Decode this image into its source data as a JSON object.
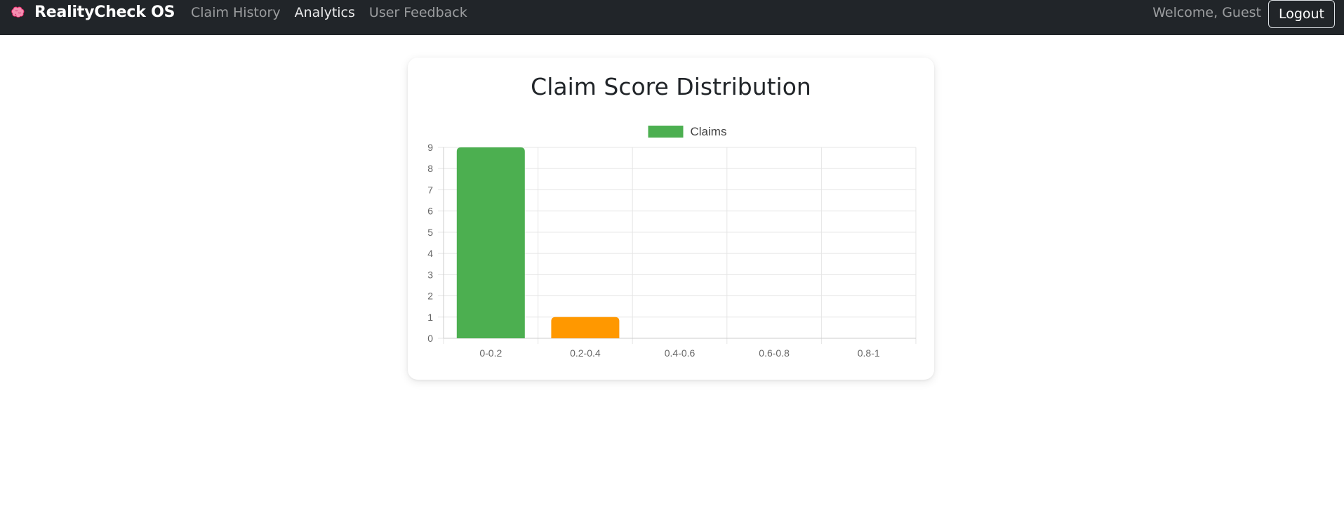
{
  "navbar": {
    "brand_icon": "brain-icon",
    "brand_name": "RealityCheck OS",
    "links": [
      {
        "label": "Claim History",
        "active": false
      },
      {
        "label": "Analytics",
        "active": true
      },
      {
        "label": "User Feedback",
        "active": false
      }
    ],
    "welcome": "Welcome, Guest",
    "logout_label": "Logout"
  },
  "card": {
    "title": "Claim Score Distribution"
  },
  "chart_data": {
    "type": "bar",
    "title": "",
    "xlabel": "",
    "ylabel": "",
    "categories": [
      "0-0.2",
      "0.2-0.4",
      "0.4-0.6",
      "0.6-0.8",
      "0.8-1"
    ],
    "series": [
      {
        "name": "Claims",
        "values": [
          9,
          1,
          0,
          0,
          0
        ]
      }
    ],
    "bar_colors": [
      "#4caf50",
      "#ff9800",
      "#4caf50",
      "#4caf50",
      "#4caf50"
    ],
    "legend_color": "#4caf50",
    "legend_position": "top",
    "yticks": [
      0,
      1,
      2,
      3,
      4,
      5,
      6,
      7,
      8,
      9
    ],
    "ylim": [
      0,
      9
    ],
    "grid": true
  }
}
